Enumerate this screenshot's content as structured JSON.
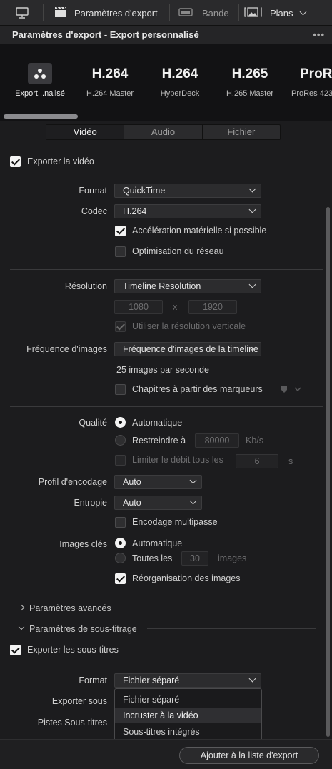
{
  "toolbar": {
    "render_label": "Paramètres d'export",
    "tape_label": "Bande",
    "clips_label": "Plans"
  },
  "panel": {
    "title": "Paramètres d'export - Export personnalisé",
    "more": "•••"
  },
  "presets": [
    {
      "big": "",
      "sub": "Export...nalisé"
    },
    {
      "big": "H.264",
      "sub": "H.264 Master"
    },
    {
      "big": "H.264",
      "sub": "HyperDeck"
    },
    {
      "big": "H.265",
      "sub": "H.265 Master"
    },
    {
      "big": "ProRe",
      "sub": "ProRes 423"
    }
  ],
  "tabs": [
    "Vidéo",
    "Audio",
    "Fichier"
  ],
  "video": {
    "export_video": "Exporter la vidéo",
    "format_label": "Format",
    "format_value": "QuickTime",
    "codec_label": "Codec",
    "codec_value": "H.264",
    "hw_accel": "Accélération matérielle si possible",
    "net_opt": "Optimisation du réseau",
    "resolution_label": "Résolution",
    "resolution_value": "Timeline Resolution",
    "res_w": "1080",
    "res_x": "x",
    "res_h": "1920",
    "vertical_res": "Utiliser la résolution verticale",
    "fps_label": "Fréquence d'images",
    "fps_value": "Fréquence d'images de la timeline",
    "fps_text": "25 images par seconde",
    "chapters": "Chapitres à partir des marqueurs",
    "quality_label": "Qualité",
    "quality_auto": "Automatique",
    "quality_restrict": "Restreindre à",
    "quality_kbps": "80000",
    "quality_unit": "Kb/s",
    "limit_rate": "Limiter le débit tous les",
    "limit_value": "6",
    "limit_unit": "s",
    "profile_label": "Profil d'encodage",
    "profile_value": "Auto",
    "entropy_label": "Entropie",
    "entropy_value": "Auto",
    "multipass": "Encodage multipasse",
    "keyframes_label": "Images clés",
    "keyframes_auto": "Automatique",
    "keyframes_every": "Toutes les",
    "keyframes_value": "30",
    "keyframes_unit": "images",
    "reorder": "Réorganisation des images"
  },
  "advanced": {
    "advanced_label": "Paramètres avancés",
    "subtitles_label": "Paramètres de sous-titrage",
    "export_subs": "Exporter les sous-titres",
    "sub_format_label": "Format",
    "sub_format_value": "Fichier séparé",
    "export_as_label": "Exporter sous",
    "tracks_label": "Pistes Sous-titres",
    "dropdown_options": [
      "Fichier séparé",
      "Incruster à la vidéo",
      "Sous-titres intégrés"
    ]
  },
  "add_button": "Ajouter à la liste d'export"
}
